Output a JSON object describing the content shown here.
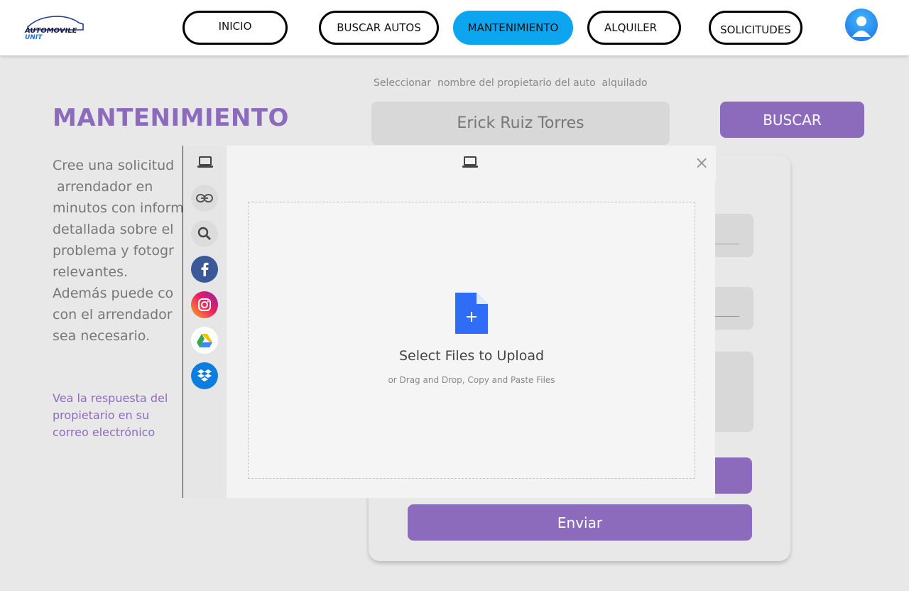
{
  "header": {
    "logo_top": "AUTOMOVILE",
    "logo_bottom": "UNIT",
    "nav": [
      "INICIO",
      "BUSCAR AUTOS",
      "MANTENIMIENTO",
      "ALQUILER",
      "SOLICITUDES"
    ],
    "active_nav": "MANTENIMIENTO",
    "accent_color": "#0ea5f0"
  },
  "page": {
    "title": "MANTENIMIENTO",
    "intro_lines": [
      "Cree una solicitud",
      " arrendador en",
      "minutos con inform",
      "detallada sobre el",
      "problema y fotogr",
      "relevantes.",
      "Además puede co",
      "con el arrendador",
      "sea necesario."
    ],
    "response_note": "Vea la respuesta del propietario en su correo electrónico",
    "brand_color": "#8c6bbd"
  },
  "search": {
    "label": "Seleccionar  nombre del propietario del auto  alquilado",
    "value": "Erick Ruiz Torres",
    "button": "BUSCAR"
  },
  "form": {
    "send_button": "Enviar"
  },
  "picker": {
    "sources": [
      "computer-icon",
      "link-icon",
      "search-icon",
      "facebook-icon",
      "instagram-icon",
      "google-drive-icon",
      "dropbox-icon"
    ],
    "dropzone_title": "Select Files to Upload",
    "dropzone_subtitle": "or Drag and Drop, Copy and Paste Files",
    "close_symbol": "×"
  }
}
